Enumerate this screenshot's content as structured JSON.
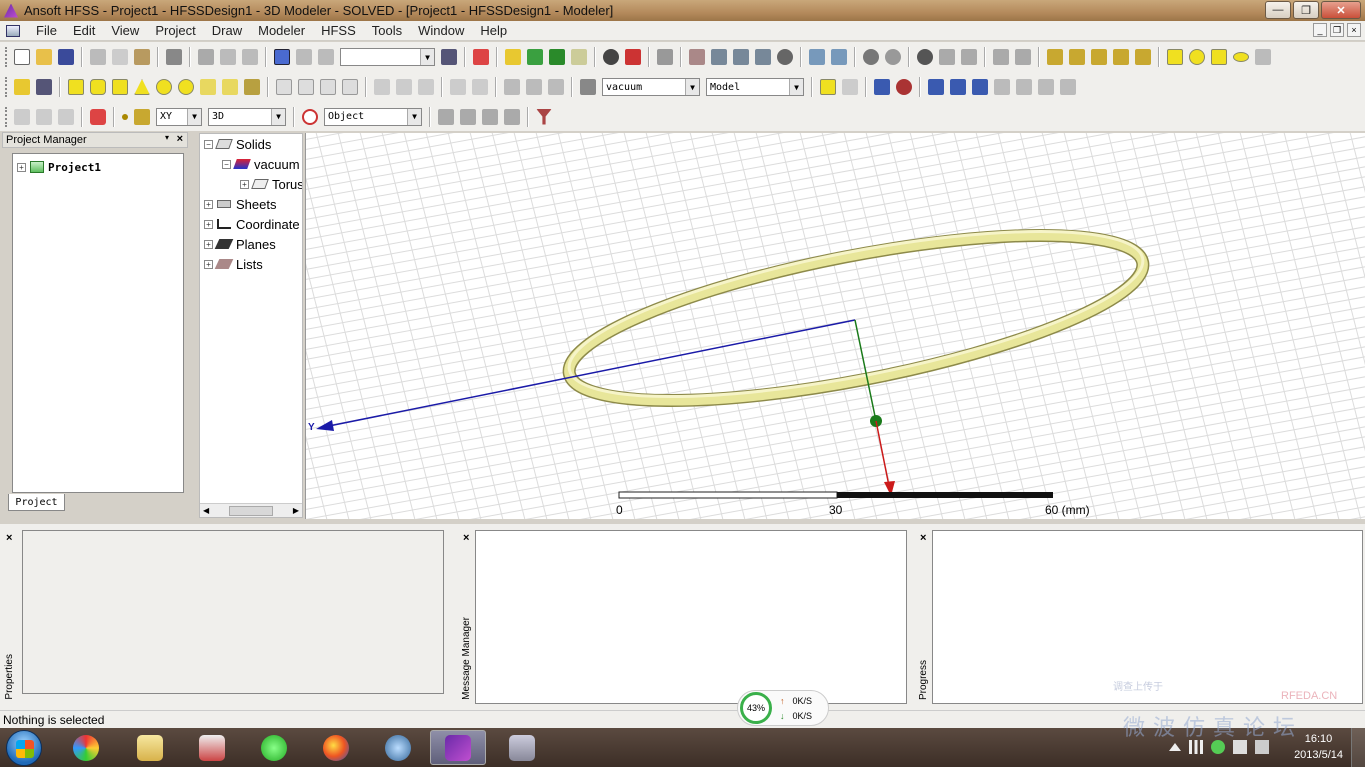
{
  "window": {
    "title": "Ansoft HFSS  - Project1 - HFSSDesign1 - 3D Modeler - SOLVED - [Project1 - HFSSDesign1 - Modeler]",
    "minimize": "—",
    "maximize": "❐",
    "close": "✕"
  },
  "menu": [
    "File",
    "Edit",
    "View",
    "Project",
    "Draw",
    "Modeler",
    "HFSS",
    "Tools",
    "Window",
    "Help"
  ],
  "mdi_buttons": [
    "_",
    "❐",
    "×"
  ],
  "toolbar": {
    "top_combo": "",
    "material_combo": "vacuum",
    "model_combo": "Model",
    "plane_combo": "XY",
    "dimension_combo": "3D",
    "select_mode_combo": "Object"
  },
  "project_manager": {
    "header": "Project Manager",
    "close": "×",
    "pin": "▾",
    "project_name": "Project1",
    "tab_label": "Project"
  },
  "model_tree": {
    "items": [
      {
        "label": "Solids",
        "expander": "−"
      },
      {
        "label": "vacuum",
        "expander": "−"
      },
      {
        "label": "Torus",
        "expander": "+"
      },
      {
        "label": "Sheets",
        "expander": "+"
      },
      {
        "label": "Coordinate Systems",
        "expander": "+"
      },
      {
        "label": "Planes",
        "expander": "+"
      },
      {
        "label": "Lists",
        "expander": "+"
      }
    ]
  },
  "viewport": {
    "axis_label": "Y",
    "scale_ticks": [
      "0",
      "30",
      "60 (mm)"
    ],
    "colors": {
      "torus": "#e8e69a",
      "y_axis": "#1a1aa8",
      "z_axis": "#1a7a1a",
      "x_axis": "#cc1a1a",
      "grid": "#d8d8d8"
    }
  },
  "panels": {
    "properties_label": "Properties",
    "message_label": "Message Manager",
    "progress_label": "Progress",
    "close": "×"
  },
  "status": {
    "text": "Nothing is selected",
    "speed_percent": "43%",
    "upload": "0K/S",
    "download": "0K/S"
  },
  "taskbar": {
    "time": "16:10",
    "date": "2013/5/14"
  },
  "watermark": {
    "main": "微波仿真论坛",
    "top": "调查上传于",
    "site": "RFEDA.CN"
  }
}
